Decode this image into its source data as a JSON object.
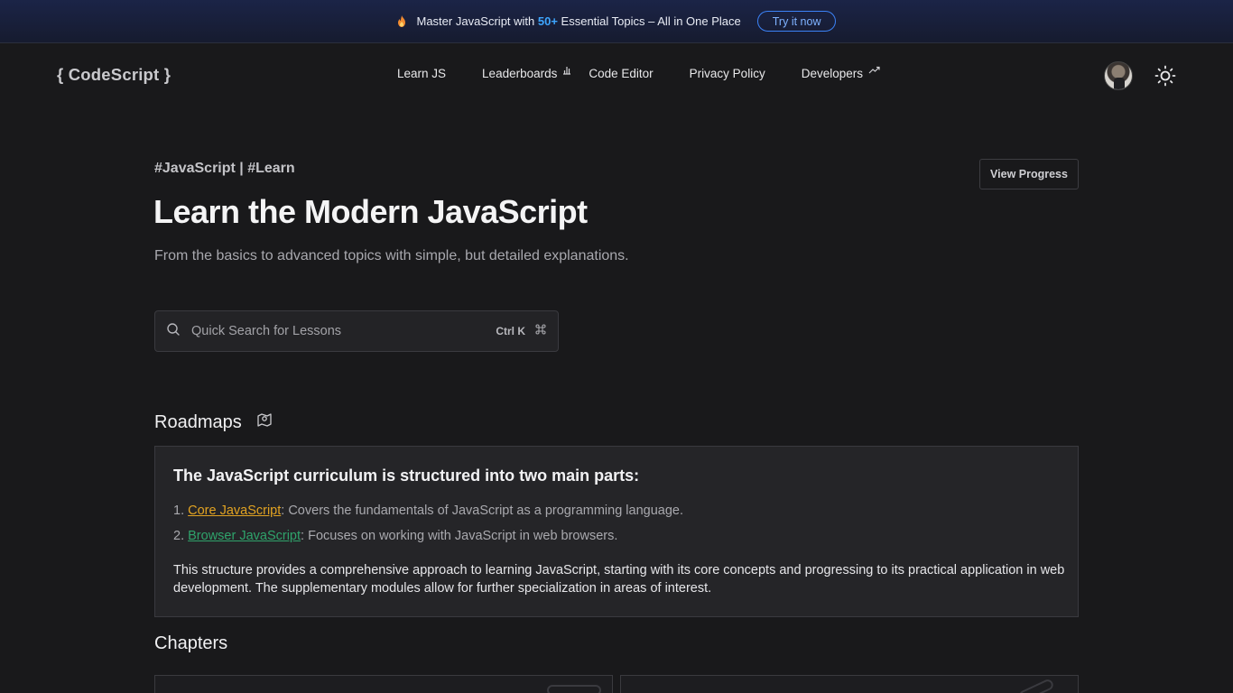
{
  "banner": {
    "text_before": "Master JavaScript with ",
    "highlight": "50+",
    "text_after": " Essential Topics – All in One Place",
    "cta": "Try it now",
    "icon": "flame-icon"
  },
  "header": {
    "logo": "{ CodeScript }",
    "nav": [
      {
        "label": "Learn JS"
      },
      {
        "label": "Leaderboards",
        "icon": "bar-chart-icon"
      },
      {
        "label": "Code Editor"
      },
      {
        "label": "Privacy Policy"
      },
      {
        "label": "Developers",
        "icon": "trending-up-icon"
      }
    ],
    "theme_icon": "sun-icon"
  },
  "hero": {
    "tags": "#JavaScript | #Learn",
    "title": "Learn the Modern JavaScript",
    "subtitle": "From the basics to advanced topics with simple, but detailed explanations.",
    "view_progress": "View Progress"
  },
  "search": {
    "placeholder": "Quick Search for Lessons",
    "shortcut": "Ctrl K",
    "shortcut_icon": "command-icon"
  },
  "roadmaps": {
    "title": "Roadmaps",
    "icon": "map-pin-icon",
    "heading": "The JavaScript curriculum is structured into two main parts:",
    "items": [
      {
        "num": "1. ",
        "link": "Core JavaScript",
        "desc": ": Covers the fundamentals of JavaScript as a programming language."
      },
      {
        "num": "2. ",
        "link": "Browser JavaScript",
        "desc": ": Focuses on working with JavaScript in web browsers."
      }
    ],
    "summary": "This structure provides a comprehensive approach to learning JavaScript, starting with its core concepts and progressing to its practical application in web development. The supplementary modules allow for further specialization in areas of interest."
  },
  "chapters": {
    "title": "Chapters"
  },
  "colors": {
    "background": "#19191b",
    "accent_blue": "#3ea6ff",
    "core_link": "#e2a322",
    "browser_link": "#2fa36b"
  }
}
